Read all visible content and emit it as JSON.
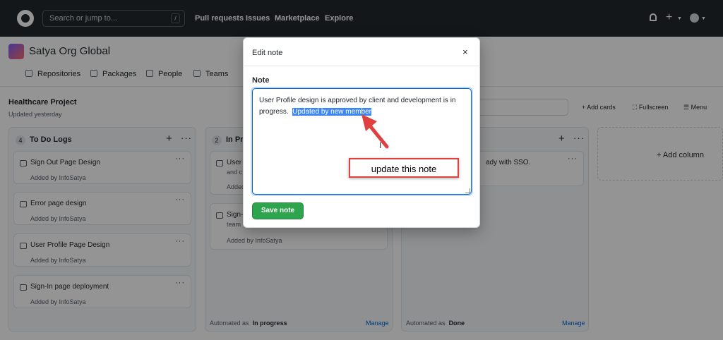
{
  "topbar": {
    "search_placeholder": "Search or jump to...",
    "search_kbd": "/",
    "nav": [
      "Pull requests",
      "Issues",
      "Marketplace",
      "Explore"
    ]
  },
  "org": {
    "name": "Satya Org Global",
    "tabs": [
      "Repositories",
      "Packages",
      "People",
      "Teams"
    ]
  },
  "project": {
    "title": "Healthcare Project",
    "updated": "Updated yesterday",
    "actions": [
      "Add cards",
      "Fullscreen",
      "Menu"
    ]
  },
  "columns": [
    {
      "count": "4",
      "title": "To Do Logs",
      "cards": [
        {
          "title": "Sign Out Page Design",
          "added_by": "Added by InfoSatya"
        },
        {
          "title": "Error page design",
          "added_by": "Added by InfoSatya"
        },
        {
          "title": "User Profile Page Design",
          "added_by": "Added by InfoSatya"
        },
        {
          "title": "Sign-In page deployment",
          "added_by": "Added by InfoSatya"
        }
      ]
    },
    {
      "count": "2",
      "title": "In Pr",
      "cards": [
        {
          "title": "User",
          "line2": "and c",
          "added_by": "Added"
        },
        {
          "title": "Sign-",
          "line2": "team",
          "added_by": "Added by InfoSatya"
        }
      ],
      "footer_label": "Automated as",
      "footer_value": "In progress",
      "manage": "Manage"
    },
    {
      "cards": [
        {
          "title": "ady with SSO."
        }
      ],
      "footer_label": "Automated as",
      "footer_value": "Done",
      "manage": "Manage"
    }
  ],
  "add_column": "Add column",
  "modal": {
    "title": "Edit note",
    "close": "×",
    "label": "Note",
    "text_plain": "User Profile design is approved by client and development is in progress.",
    "text_selected": "Updated by new member",
    "save": "Save note"
  },
  "annotation": {
    "text": "update this note",
    "color": "#e0403f"
  },
  "colors": {
    "topbar": "#24292e",
    "primary_button": "#2ea44f",
    "link": "#0366d6"
  }
}
